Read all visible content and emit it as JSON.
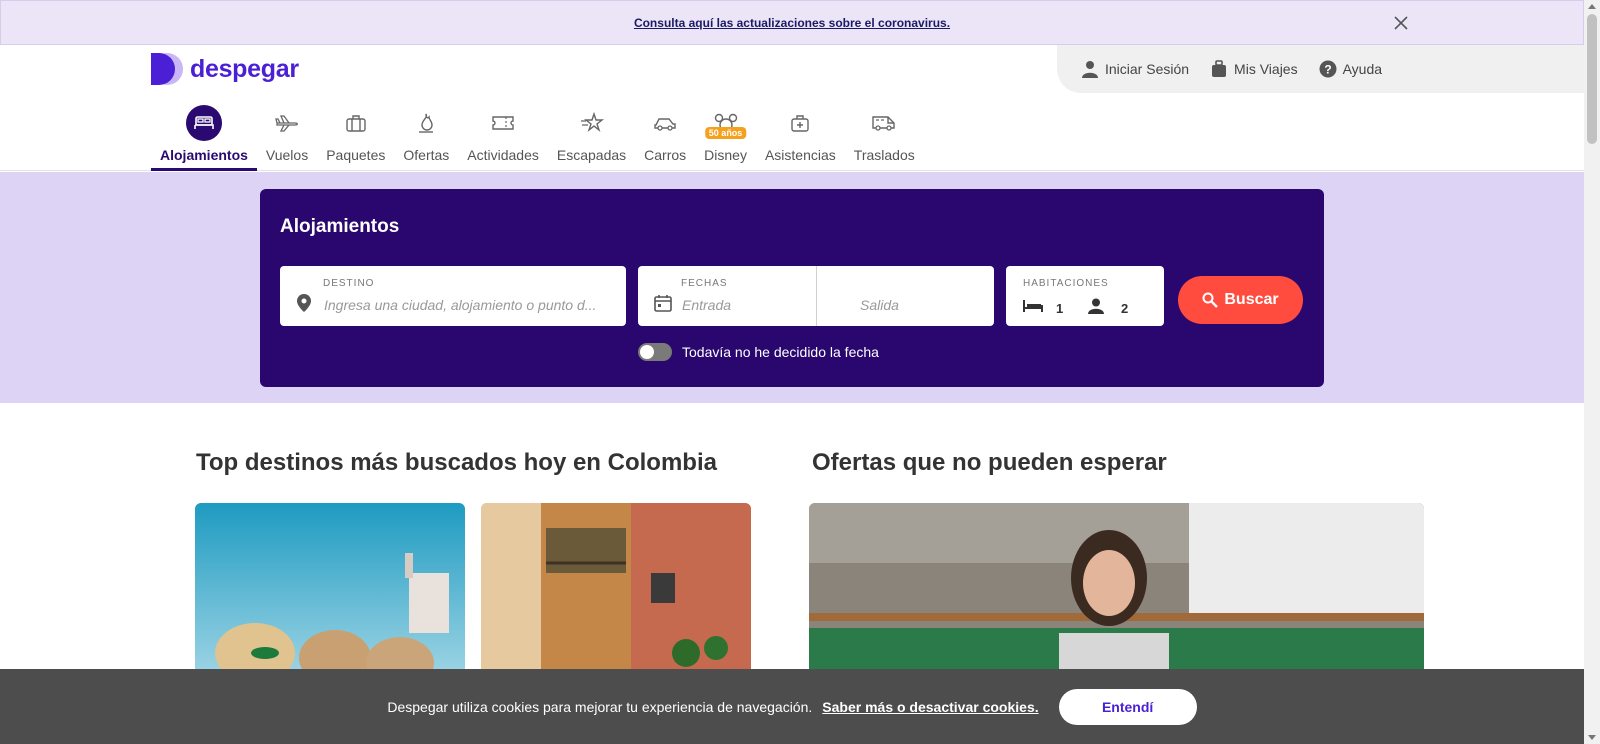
{
  "banner": {
    "link_text": "Consulta aquí las actualizaciones sobre el coronavirus.",
    "close_icon": "close-icon"
  },
  "header": {
    "logo_text": "despegar",
    "user_links": [
      {
        "label": "Iniciar Sesión",
        "icon": "user-icon"
      },
      {
        "label": "Mis Viajes",
        "icon": "suitcase-icon"
      },
      {
        "label": "Ayuda",
        "icon": "help-icon"
      }
    ],
    "nav": [
      {
        "label": "Alojamientos",
        "icon": "bed-icon",
        "active": true
      },
      {
        "label": "Vuelos",
        "icon": "plane-icon"
      },
      {
        "label": "Paquetes",
        "icon": "package-icon"
      },
      {
        "label": "Ofertas",
        "icon": "flame-icon"
      },
      {
        "label": "Actividades",
        "icon": "ticket-icon"
      },
      {
        "label": "Escapadas",
        "icon": "star-icon"
      },
      {
        "label": "Carros",
        "icon": "car-icon"
      },
      {
        "label": "Disney",
        "icon": "mickey-icon",
        "badge": "50 años"
      },
      {
        "label": "Asistencias",
        "icon": "medkit-icon"
      },
      {
        "label": "Traslados",
        "icon": "van-icon"
      }
    ]
  },
  "search": {
    "title": "Alojamientos",
    "destino_caption": "DESTINO",
    "destino_placeholder": "Ingresa una ciudad, alojamiento o punto d...",
    "fechas_caption": "FECHAS",
    "entrada_placeholder": "Entrada",
    "salida_placeholder": "Salida",
    "habitaciones_caption": "HABITACIONES",
    "rooms": "1",
    "guests": "2",
    "button_label": "Buscar",
    "toggle_label": "Todavía no he decidido la fecha"
  },
  "sections": {
    "top_destinos_title": "Top destinos más buscados hoy en Colombia",
    "ofertas_title": "Ofertas que no pueden esperar"
  },
  "cookie": {
    "text": "Despegar utiliza cookies para mejorar tu experiencia de navegación.",
    "link": "Saber más o desactivar cookies.",
    "button": "Entendí"
  },
  "colors": {
    "brand": "#4a1fd6",
    "navy": "#29076e",
    "accent": "#ff4c3f",
    "hero_bg": "#ddd3f5"
  }
}
